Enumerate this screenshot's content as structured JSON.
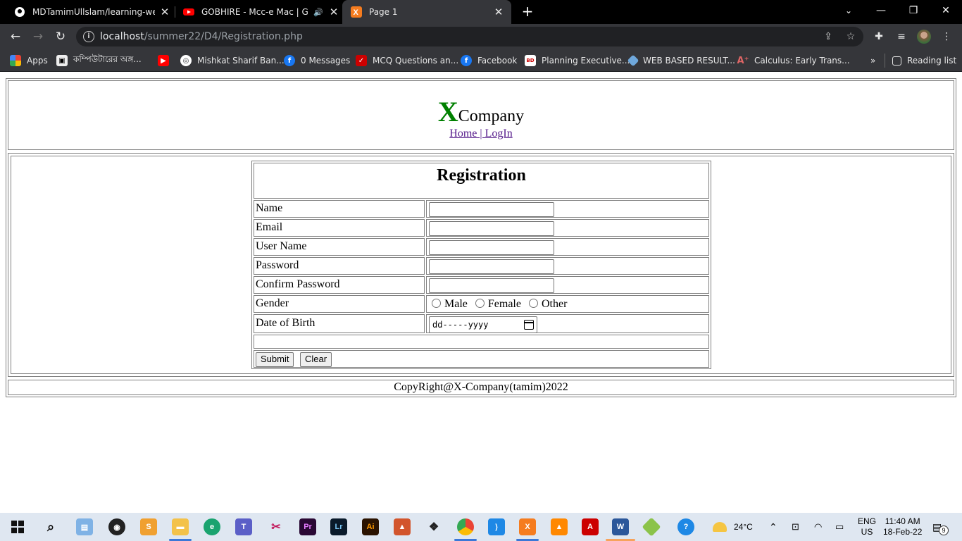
{
  "browser": {
    "tabs": [
      {
        "title": "MDTamimUllslam/learning-web-t",
        "icon": "github-icon"
      },
      {
        "title": "GOBHIRE - Mcc-e Mac | Gk K",
        "icon": "youtube-icon"
      },
      {
        "title": "Page 1",
        "icon": "xampp-icon"
      }
    ],
    "url_host": "localhost",
    "url_path": "/summer22/D4/Registration.php",
    "bookmarks": [
      {
        "label": "Apps",
        "icon": "apps-grid-icon"
      },
      {
        "label": "কম্পিউটারের অঙ্গ...",
        "icon": "site-icon"
      },
      {
        "label": "",
        "icon": "youtube-icon"
      },
      {
        "label": "Mishkat Sharif Ban...",
        "icon": "globe-icon"
      },
      {
        "label": "0 Messages",
        "icon": "facebook-icon"
      },
      {
        "label": "MCQ Questions an...",
        "icon": "site-icon"
      },
      {
        "label": "Facebook",
        "icon": "facebook-icon"
      },
      {
        "label": "Planning Executive...",
        "icon": "site-icon"
      },
      {
        "label": "WEB BASED RESULT...",
        "icon": "site-icon"
      },
      {
        "label": "Calculus: Early Trans...",
        "icon": "site-icon"
      }
    ],
    "more": "»",
    "reading_list": "Reading list"
  },
  "page": {
    "brand_x": "X",
    "brand_rest": "Company",
    "nav_home": "Home",
    "nav_sep": " | ",
    "nav_login": "LogIn",
    "form_title": "Registration",
    "fields": {
      "name": "Name",
      "email": "Email",
      "username": "User Name",
      "password": "Password",
      "confirm": "Confirm Password",
      "gender": "Gender",
      "dob": "Date of Birth"
    },
    "gender_options": [
      "Male",
      "Female",
      "Other"
    ],
    "dob_placeholder": "dd-----yyyy",
    "submit": "Submit",
    "clear": "Clear",
    "footer": "CopyRight@X-Company(tamim)2022"
  },
  "taskbar": {
    "weather": "24°C",
    "lang1": "ENG",
    "lang2": "US",
    "time": "11:40 AM",
    "date": "18-Feb-22",
    "notifications": "9"
  }
}
